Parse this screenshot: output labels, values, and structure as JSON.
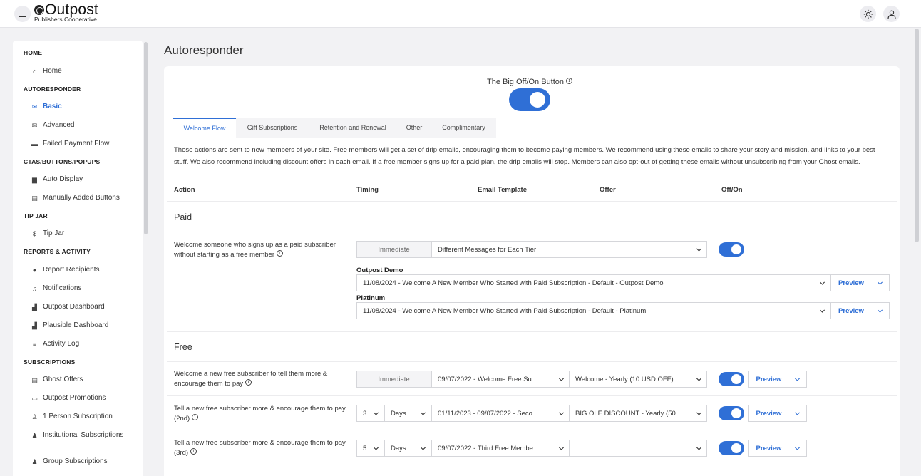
{
  "header": {
    "brand_title": "Outpost",
    "brand_subtitle": "Publishers Cooperative",
    "menu_icon": "hamburger-icon",
    "theme_icon": "sun-icon",
    "account_icon": "user-icon"
  },
  "sidebar": {
    "sections": [
      {
        "heading": "HOME",
        "items": [
          {
            "label": "Home",
            "icon": "home-icon"
          }
        ]
      },
      {
        "heading": "AUTORESPONDER",
        "items": [
          {
            "label": "Basic",
            "icon": "mail-icon",
            "active": true
          },
          {
            "label": "Advanced",
            "icon": "mail-icon"
          },
          {
            "label": "Failed Payment Flow",
            "icon": "card-icon"
          }
        ]
      },
      {
        "heading": "CTAS/BUTTONS/POPUPS",
        "items": [
          {
            "label": "Auto Display",
            "icon": "window-icon"
          },
          {
            "label": "Manually Added Buttons",
            "icon": "layout-icon"
          }
        ]
      },
      {
        "heading": "TIP JAR",
        "items": [
          {
            "label": "Tip Jar",
            "icon": "dollar-icon"
          }
        ]
      },
      {
        "heading": "REPORTS & ACTIVITY",
        "items": [
          {
            "label": "Report Recipients",
            "icon": "person-icon"
          },
          {
            "label": "Notifications",
            "icon": "bell-icon"
          },
          {
            "label": "Outpost Dashboard",
            "icon": "bar-chart-icon"
          },
          {
            "label": "Plausible Dashboard",
            "icon": "bar-chart-icon"
          },
          {
            "label": "Activity Log",
            "icon": "activity-icon"
          }
        ]
      },
      {
        "heading": "SUBSCRIPTIONS",
        "items": [
          {
            "label": "Ghost Offers",
            "icon": "document-icon"
          },
          {
            "label": "Outpost Promotions",
            "icon": "ticket-icon"
          },
          {
            "label": "1 Person Subscription",
            "icon": "user-icon"
          },
          {
            "label": "Institutional Subscriptions",
            "icon": "group-icon"
          },
          {
            "label": "Group Subscriptions",
            "icon": "group-icon"
          }
        ]
      }
    ]
  },
  "main": {
    "page_title": "Autoresponder",
    "big_button_label": "The Big Off/On Button",
    "big_button_on": true,
    "tabs": [
      {
        "label": "Welcome Flow",
        "active": true
      },
      {
        "label": "Gift Subscriptions"
      },
      {
        "label": "Retention and Renewal"
      },
      {
        "label": "Other"
      },
      {
        "label": "Complimentary"
      }
    ],
    "description": "These actions are sent to new members of your site. Free members will get a set of drip emails, encouraging them to become paying members. We recommend using these emails to share your story and mission, and links to your best stuff. We also recommend including discount offers in each email. If a free member signs up for a paid plan, the drip emails will stop. Members can also opt-out of getting these emails without unsubscribing from your Ghost emails.",
    "columns": [
      "Action",
      "Timing",
      "Email Template",
      "Offer",
      "Off/On"
    ],
    "paid": {
      "title": "Paid",
      "action": "Welcome someone who signs up as a paid subscriber without starting as a free member",
      "timing": "Immediate",
      "template_mode": "Different Messages for Each Tier",
      "enabled": true,
      "tiers": [
        {
          "name": "Outpost Demo",
          "template": "11/08/2024 - Welcome A New Member Who Started with Paid Subscription - Default - Outpost Demo",
          "preview": "Preview"
        },
        {
          "name": "Platinum",
          "template": "11/08/2024 - Welcome A New Member Who Started with Paid Subscription - Default - Platinum",
          "preview": "Preview"
        }
      ]
    },
    "free": {
      "title": "Free",
      "rows": [
        {
          "action": "Welcome a new free subscriber to tell them more & encourage them to pay",
          "timing": "Immediate",
          "template": "09/07/2022 - Welcome Free Su...",
          "offer": "Welcome - Yearly (10 USD OFF)",
          "enabled": true,
          "preview": "Preview"
        },
        {
          "action": "Tell a new free subscriber more & encourage them to pay (2nd)",
          "timing_value": "3",
          "timing_unit": "Days",
          "template": "01/11/2023 - 09/07/2022 - Seco...",
          "offer": "BIG OLE DISCOUNT - Yearly (50...",
          "enabled": true,
          "preview": "Preview"
        },
        {
          "action": "Tell a new free subscriber more & encourage them to pay (3rd)",
          "timing_value": "5",
          "timing_unit": "Days",
          "template": "09/07/2022 - Third Free Membe...",
          "offer": "",
          "enabled": true,
          "preview": "Preview"
        }
      ]
    }
  }
}
